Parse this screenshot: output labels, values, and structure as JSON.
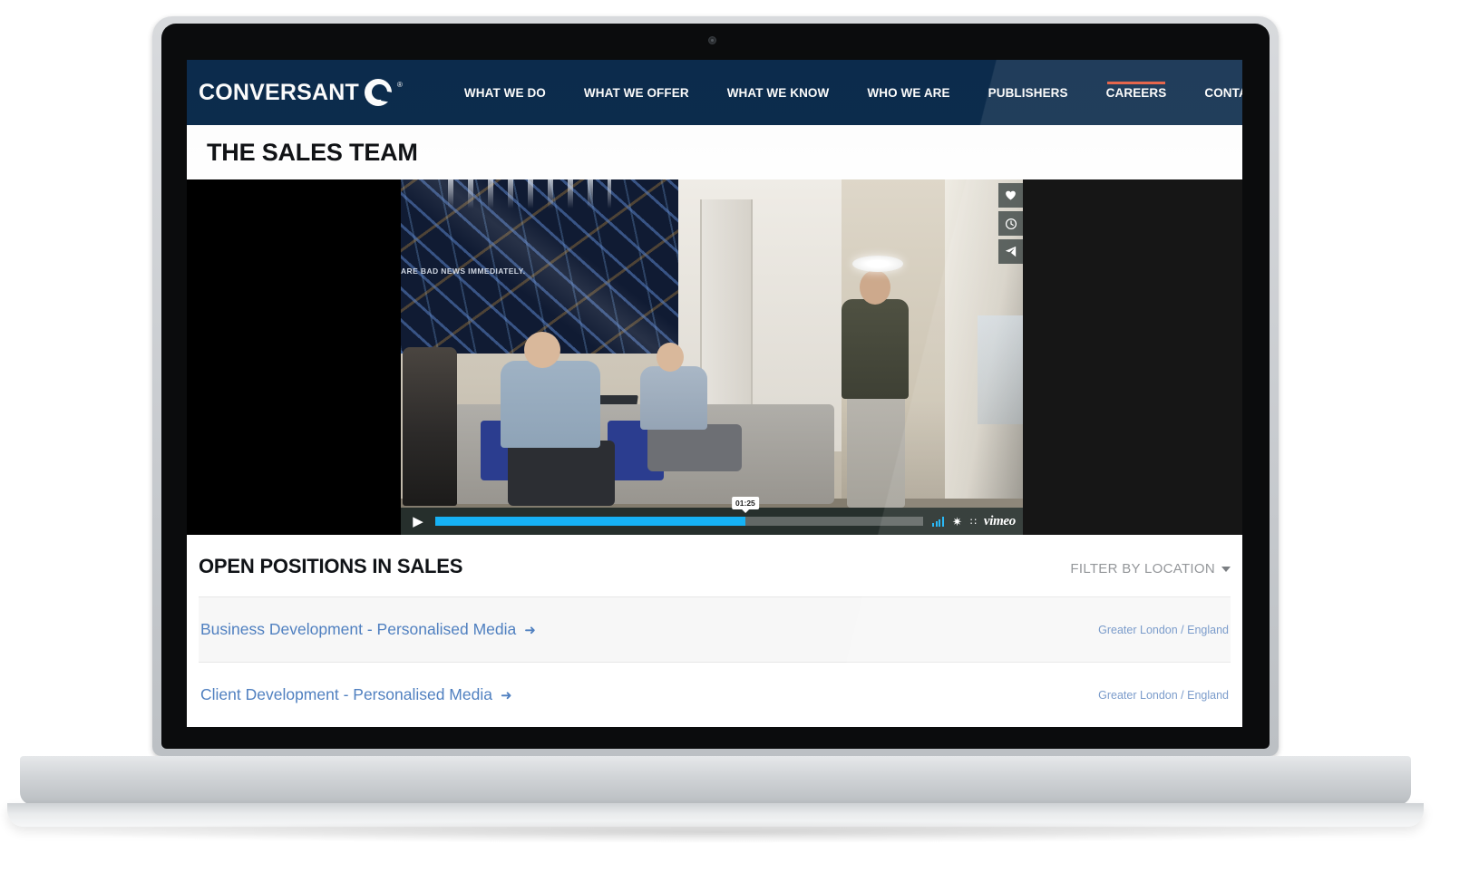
{
  "site": {
    "brand": {
      "word": "CONVERSANT",
      "registered": "®",
      "mark_icon": "conversant-logo-icon"
    },
    "nav": {
      "items": [
        {
          "label": "WHAT WE DO",
          "active": false
        },
        {
          "label": "WHAT WE OFFER",
          "active": false
        },
        {
          "label": "WHAT WE KNOW",
          "active": false
        },
        {
          "label": "WHO WE ARE",
          "active": false
        },
        {
          "label": "PUBLISHERS",
          "active": false
        },
        {
          "label": "CAREERS",
          "active": true
        },
        {
          "label": "CONTACT",
          "active": false
        }
      ],
      "search_icon": "search-icon",
      "bg_color": "#0c2c4d",
      "active_underline_color": "#e8593c"
    },
    "page_title": "THE SALES TEAM",
    "video": {
      "provider": "vimeo",
      "provider_logo": "vimeo",
      "play_icon": "play-icon",
      "current_time": "01:25",
      "progress_percent": 63.5,
      "progress_color": "#16b2f5",
      "side_actions": [
        {
          "name": "like-button",
          "glyph": "♥"
        },
        {
          "name": "watch-later-button",
          "glyph": "🕐"
        },
        {
          "name": "share-button",
          "glyph": "➤"
        }
      ],
      "volume_icon": "volume-bars-icon",
      "settings_icon": "gear-icon",
      "quality_icon": "hd-icon",
      "mural_text": "ARE BAD NEWS IMMEDIATELY."
    },
    "positions": {
      "title": "OPEN POSITIONS IN SALES",
      "filter_label": "FILTER BY LOCATION",
      "filter_caret_icon": "chevron-down-icon",
      "jobs": [
        {
          "title": "Business Development - Personalised Media",
          "arrow_icon": "arrow-right-icon",
          "location": "Greater London / England"
        },
        {
          "title": "Client Development - Personalised Media",
          "arrow_icon": "arrow-right-icon",
          "location": "Greater London / England"
        }
      ]
    }
  }
}
